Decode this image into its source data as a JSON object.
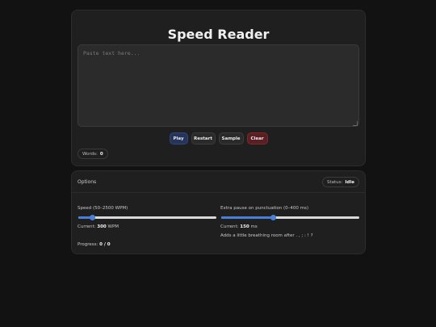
{
  "app": {
    "title": "Speed Reader"
  },
  "input": {
    "placeholder": "Paste text here...",
    "value": ""
  },
  "buttons": {
    "play": "Play",
    "restart": "Restart",
    "sample": "Sample",
    "clear": "Clear"
  },
  "words": {
    "label": "Words:",
    "count": "0"
  },
  "options": {
    "title": "Options",
    "status_label": "Status:",
    "status_value": "Idle",
    "speed": {
      "label": "Speed (50–2500 WPM)",
      "min": 50,
      "max": 2500,
      "value": 300,
      "current_label": "Current:",
      "current_value": "300",
      "current_unit": "WPM"
    },
    "pause": {
      "label": "Extra pause on punctuation (0–400 ms)",
      "min": 0,
      "max": 400,
      "value": 150,
      "current_label": "Current:",
      "current_value": "150",
      "current_unit": "ms",
      "hint": "Adds a little breathing room after . , ; : ! ?"
    },
    "progress": {
      "label": "Progress:",
      "value": "0 / 0"
    }
  },
  "colors": {
    "accent": "#4a7fd6",
    "play_bg": "#24345a",
    "clear_bg": "#5a1f22",
    "page_bg": "#121212",
    "card_bg": "#1f1f1f"
  }
}
